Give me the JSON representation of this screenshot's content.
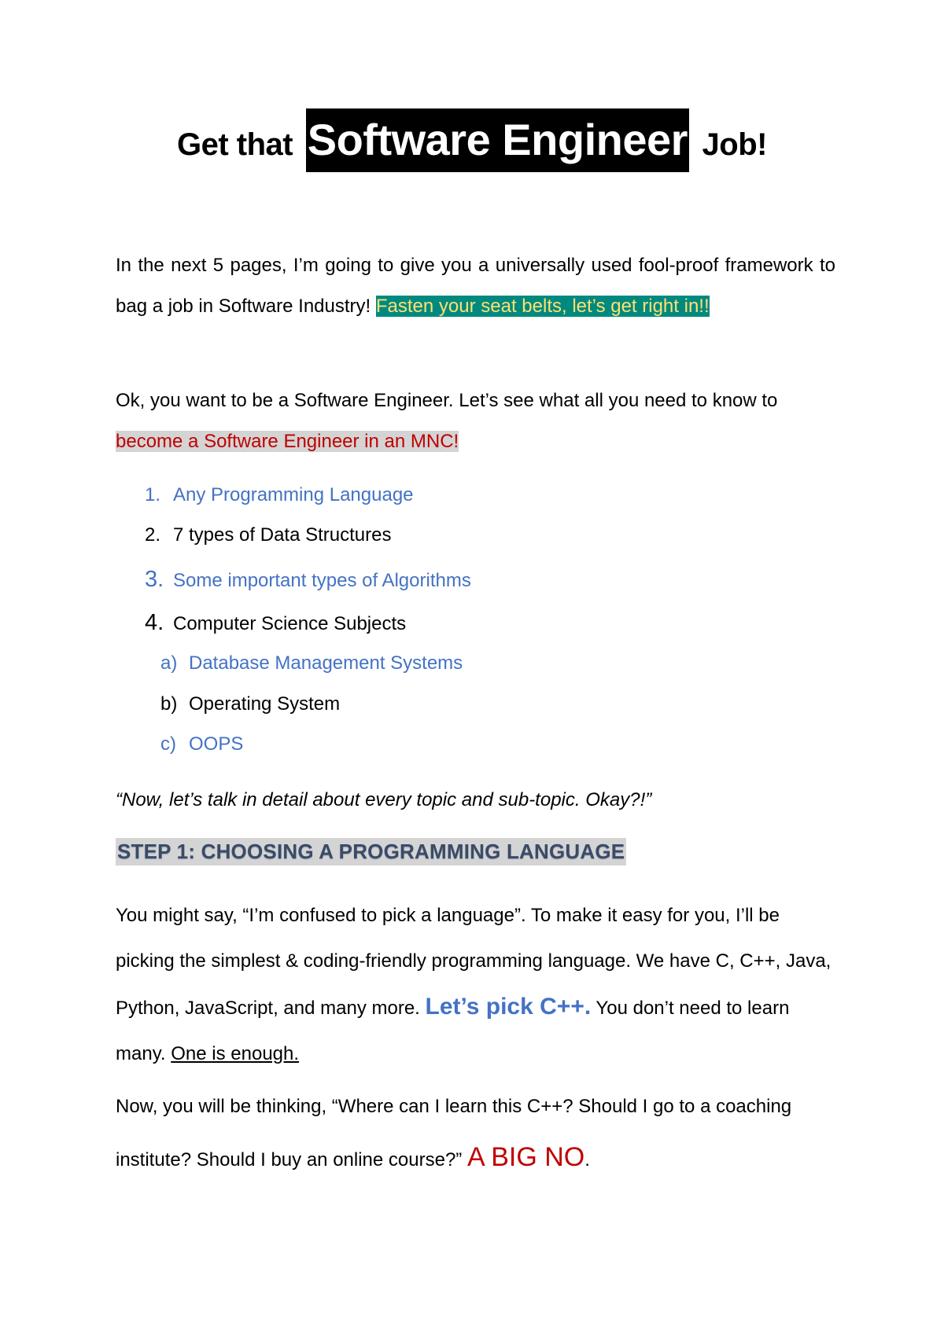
{
  "title": {
    "prefix": "Get that",
    "highlight": "Software Engineer",
    "suffix": "Job!"
  },
  "intro": {
    "text": "In the next 5 pages, I’m going to give you a universally used fool-proof framework to bag a job in Software Industry!",
    "highlight": "Fasten your seat belts, let’s get right in!!"
  },
  "need": {
    "text": "Ok, you want to be a Software Engineer. Let’s see what all you need to know to",
    "highlight": "become a Software Engineer in an MNC!"
  },
  "list": [
    {
      "num": "1.",
      "label": "Any Programming Language"
    },
    {
      "num": "2.",
      "label": "7 types of Data Structures"
    },
    {
      "num": "3.",
      "label": "Some important types of Algorithms"
    },
    {
      "num": "4.",
      "label": "Computer Science Subjects"
    }
  ],
  "sublist": [
    {
      "num": "a)",
      "label": "Database Management Systems"
    },
    {
      "num": "b)",
      "label": "Operating System"
    },
    {
      "num": "c)",
      "label": "OOPS"
    }
  ],
  "quote": "“Now, let’s talk in detail about every topic and sub-topic. Okay?!”",
  "step1": {
    "heading": "STEP 1: CHOOSING A PROGRAMMING LANGUAGE",
    "para1_a": "You might say, “I’m confused to pick a language”. To make it easy for you, I’ll be picking the simplest & coding-friendly programming language. We have C, C++, Java, Python, JavaScript, and many more.",
    "para1_pick": "Let’s pick C++.",
    "para1_b": "You don’t need to learn many.",
    "para1_underline": "One is enough.",
    "para2_a": "Now, you will be thinking, “Where can I learn this C++? Should I go to a coaching institute? Should I buy an online course?”",
    "para2_no": "A BIG NO",
    "para2_end": "."
  },
  "colors": {
    "teal_highlight": "#00897f",
    "yellow_text": "#ffe070",
    "gray_highlight": "#d4d4d4",
    "red_text": "#c00000",
    "blue_text": "#4472c4"
  }
}
